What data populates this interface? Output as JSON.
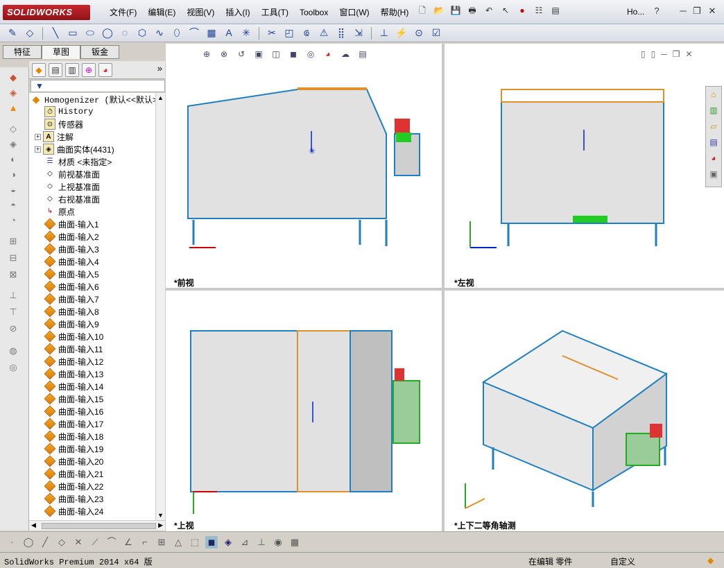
{
  "app": {
    "logo": "SOLIDWORKS",
    "doc_title": "Ho..."
  },
  "menu": [
    "文件(F)",
    "编辑(E)",
    "视图(V)",
    "插入(I)",
    "工具(T)",
    "Toolbox",
    "窗口(W)",
    "帮助(H)"
  ],
  "tabs": [
    "特征",
    "草图",
    "钣金"
  ],
  "tree": {
    "root": "Homogenizer (默认<<默认>_",
    "items": [
      "History",
      "传感器",
      "注解",
      "曲面实体(4431)",
      "材质 <未指定>",
      "前视基准面",
      "上视基准面",
      "右视基准面",
      "原点"
    ],
    "surfaces": [
      "曲面-输入1",
      "曲面-输入2",
      "曲面-输入3",
      "曲面-输入4",
      "曲面-输入5",
      "曲面-输入6",
      "曲面-输入7",
      "曲面-输入8",
      "曲面-输入9",
      "曲面-输入10",
      "曲面-输入11",
      "曲面-输入12",
      "曲面-输入13",
      "曲面-输入14",
      "曲面-输入15",
      "曲面-输入16",
      "曲面-输入17",
      "曲面-输入18",
      "曲面-输入19",
      "曲面-输入20",
      "曲面-输入21",
      "曲面-输入22",
      "曲面-输入23",
      "曲面-输入24"
    ]
  },
  "viewports": {
    "front": "*前视",
    "left": "*左视",
    "top": "*上视",
    "iso": "*上下二等角轴测"
  },
  "status": {
    "product": "SolidWorks Premium 2014 x64 版",
    "mode": "在编辑 零件",
    "units": "自定义"
  },
  "colors": {
    "accent": "#c8262d",
    "edge": "#1f7fc1",
    "highlight": "#e0902a"
  }
}
